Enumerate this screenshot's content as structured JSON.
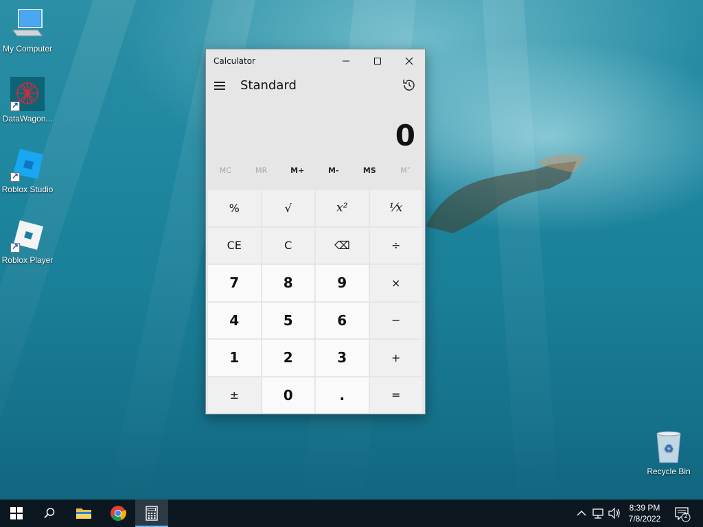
{
  "desktop": {
    "icons": [
      {
        "label": "My Computer",
        "icon": "my-computer-icon"
      },
      {
        "label": "DataWagon...",
        "icon": "datawagon-icon"
      },
      {
        "label": "Roblox Studio",
        "icon": "roblox-studio-icon"
      },
      {
        "label": "Roblox Player",
        "icon": "roblox-player-icon"
      },
      {
        "label": "Recycle Bin",
        "icon": "recycle-bin-icon"
      }
    ]
  },
  "calculator": {
    "title": "Calculator",
    "mode": "Standard",
    "display": "0",
    "memory": [
      "MC",
      "MR",
      "M+",
      "M-",
      "MS",
      "M˅"
    ],
    "keys": [
      [
        "%",
        "√",
        "x²",
        "¹⁄x"
      ],
      [
        "CE",
        "C",
        "⌫",
        "÷"
      ],
      [
        "7",
        "8",
        "9",
        "×"
      ],
      [
        "4",
        "5",
        "6",
        "−"
      ],
      [
        "1",
        "2",
        "3",
        "+"
      ],
      [
        "±",
        "0",
        ".",
        "="
      ]
    ]
  },
  "taskbar": {
    "items": [
      "start-icon",
      "search-icon",
      "file-explorer-icon",
      "chrome-icon",
      "calculator-icon"
    ],
    "clock": {
      "time": "8:39 PM",
      "date": "7/8/2022"
    },
    "notifications": "2"
  }
}
